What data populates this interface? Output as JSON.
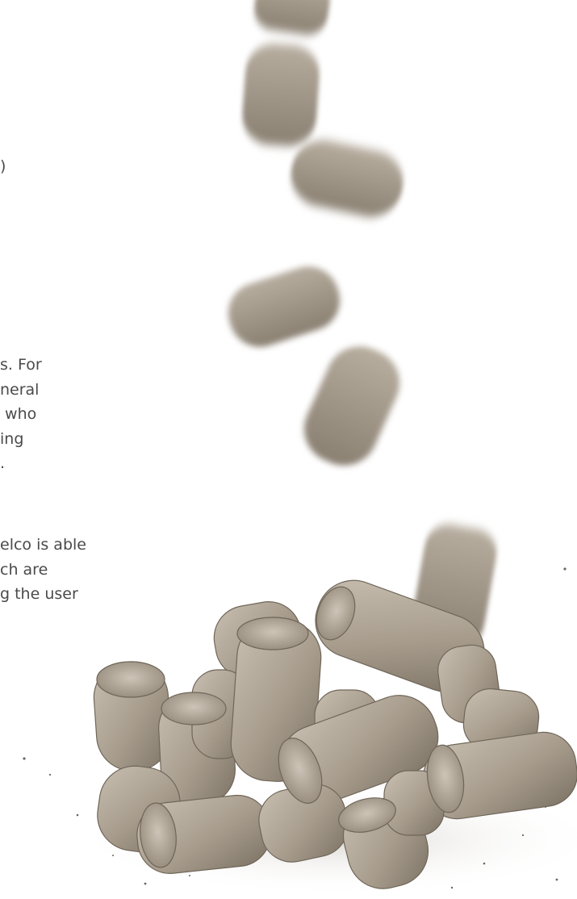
{
  "fragment_mark": ")",
  "paragraph_1": {
    "lines": [
      "s.  For",
      "neral",
      " who",
      "ing",
      "."
    ]
  },
  "paragraph_2": {
    "lines": [
      "elco is able",
      "ch are",
      "g the user"
    ]
  },
  "photo": {
    "subject": "pellets falling onto a pile of pellets",
    "pellet_color": "#a79c8c",
    "background_color": "#ffffff"
  }
}
